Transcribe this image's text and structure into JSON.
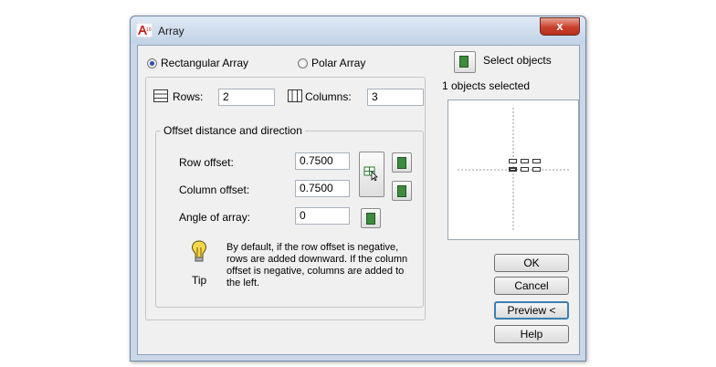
{
  "window": {
    "title": "Array",
    "close_glyph": "x"
  },
  "mode": {
    "rectangular_label": "Rectangular Array",
    "polar_label": "Polar Array",
    "selected": "rectangular"
  },
  "selection": {
    "button_label": "Select objects",
    "status": "1 objects selected"
  },
  "grid": {
    "rows_label": "Rows:",
    "rows_value": "2",
    "columns_label": "Columns:",
    "columns_value": "3"
  },
  "offset": {
    "group_title": "Offset distance and direction",
    "row_offset_label": "Row offset:",
    "row_offset_value": "0.7500",
    "column_offset_label": "Column offset:",
    "column_offset_value": "0.7500",
    "angle_label": "Angle of array:",
    "angle_value": "0"
  },
  "tip": {
    "label": "Tip",
    "text": "By default, if the row offset is negative, rows are added downward.  If the column offset is negative, columns are added to the left."
  },
  "buttons": {
    "ok": "OK",
    "cancel": "Cancel",
    "preview": "Preview <",
    "help": "Help"
  },
  "icons": {
    "app": "autocad-app-icon",
    "rows": "rows-grid-icon",
    "columns": "columns-grid-icon",
    "tip": "lightbulb-icon",
    "pick": "pick-point-icon"
  },
  "colors": {
    "titlebar": "#c2d3e8",
    "close": "#c9402b",
    "client": "#f0f0f0"
  }
}
